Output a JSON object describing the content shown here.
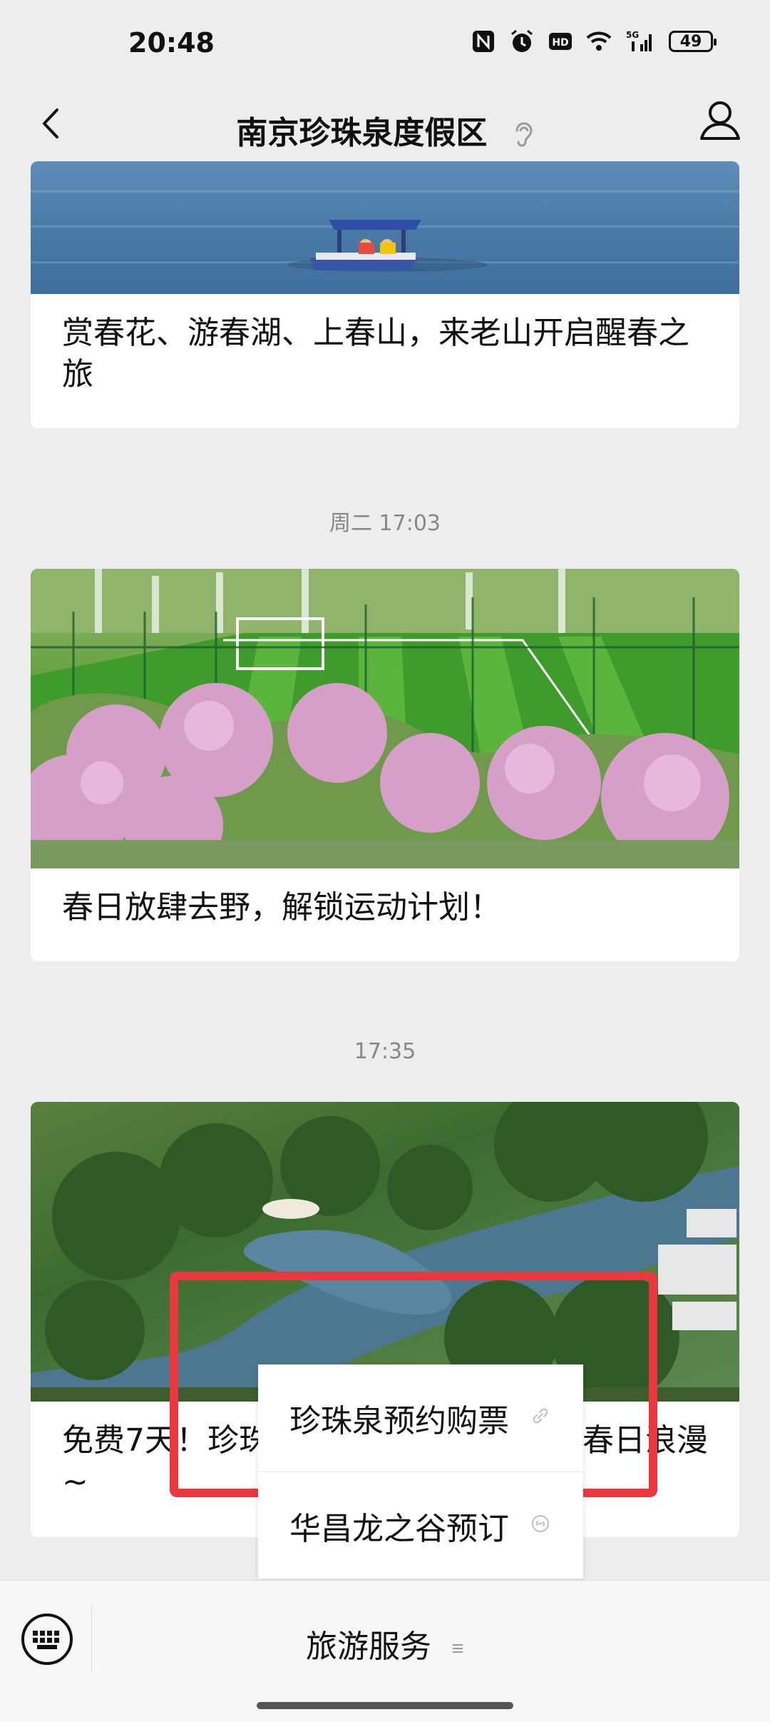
{
  "status_bar": {
    "time": "20:48",
    "network": "5G",
    "battery": "49",
    "icons": [
      "nfc-icon",
      "alarm-icon",
      "hd-icon",
      "wifi-icon",
      "signal-icon",
      "battery-icon"
    ]
  },
  "nav": {
    "title": "南京珍珠泉度假区",
    "icons": [
      "back-arrow-icon",
      "ear-icon",
      "profile-icon"
    ]
  },
  "messages": [
    {
      "title": "赏春花、游春湖、上春山，来老山开启醒春之旅"
    },
    {
      "timestamp": "周二 17:03",
      "title": "春日放肆去野，解锁运动计划！"
    },
    {
      "timestamp": "17:35",
      "title_left": "免费7天！珍珠",
      "title_right": "春日浪漫",
      "title_line2": "~"
    }
  ],
  "popup_menu": {
    "items": [
      {
        "label": "珍珠泉预约购票"
      },
      {
        "label": "华昌龙之谷预订"
      }
    ]
  },
  "bottom_bar": {
    "menu_label": "旅游服务",
    "icons": [
      "keyboard-icon",
      "submenu-icon"
    ]
  },
  "colors": {
    "highlight": "#e9393f",
    "background": "#ededed"
  }
}
